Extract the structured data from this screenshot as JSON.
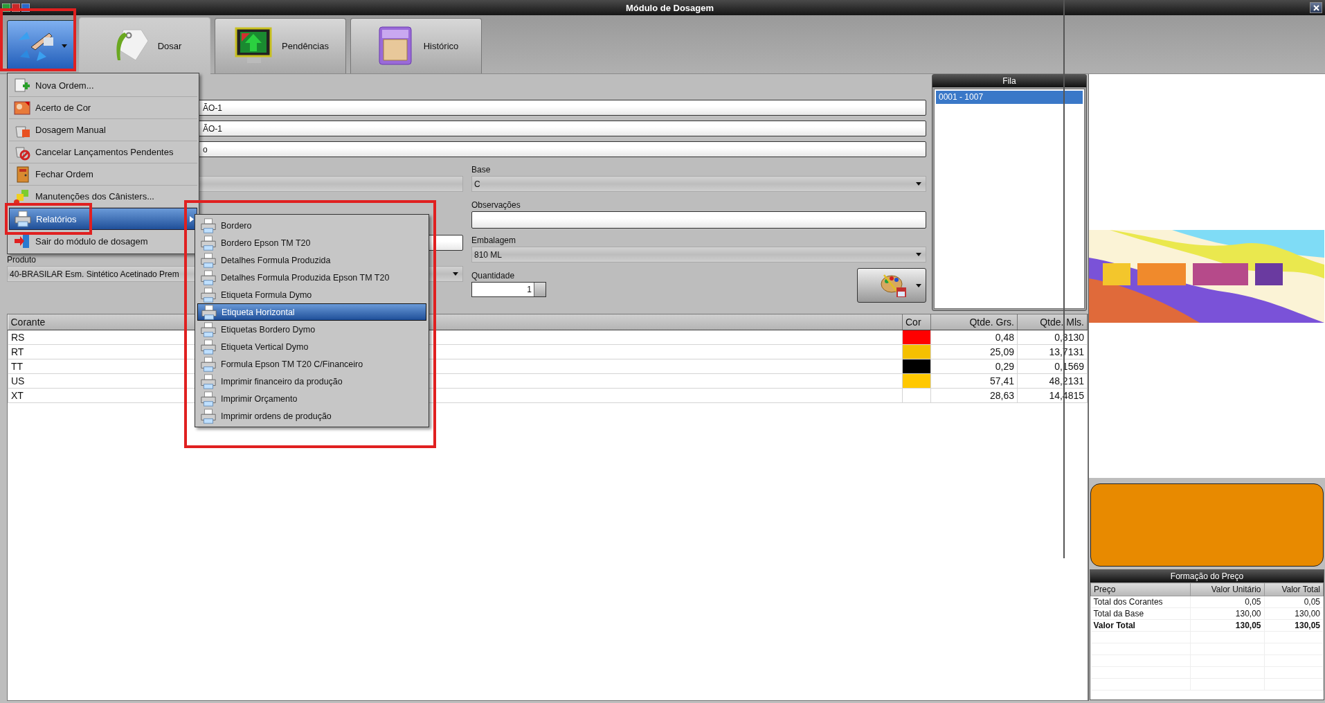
{
  "window": {
    "title": "Módulo de Dosagem"
  },
  "tabs": [
    {
      "label": "Dosar",
      "selected": true
    },
    {
      "label": "Pendências",
      "selected": false
    },
    {
      "label": "Histórico",
      "selected": false
    }
  ],
  "action_menu": {
    "items": [
      {
        "label": "Nova Ordem...",
        "selected": false
      },
      {
        "label": "Acerto de Cor",
        "selected": false
      },
      {
        "label": "Dosagem Manual",
        "selected": false
      },
      {
        "label": "Cancelar Lançamentos Pendentes",
        "selected": false
      },
      {
        "label": "Fechar Ordem",
        "selected": false
      },
      {
        "label": "Manutenções dos Cânisters...",
        "selected": false
      },
      {
        "label": "Relatórios",
        "selected": true,
        "submenu": true
      },
      {
        "label": "Sair do módulo de dosagem",
        "selected": false
      }
    ]
  },
  "submenu": {
    "items": [
      {
        "label": "Bordero",
        "selected": false
      },
      {
        "label": "Bordero Epson TM T20",
        "selected": false
      },
      {
        "label": "Detalhes Formula Produzida",
        "selected": false
      },
      {
        "label": "Detalhes Formula Produzida Epson TM T20",
        "selected": false
      },
      {
        "label": "Etiqueta Formula Dymo",
        "selected": false
      },
      {
        "label": "Etiqueta Horizontal",
        "selected": true
      },
      {
        "label": "Etiquetas Bordero Dymo",
        "selected": false
      },
      {
        "label": "Etiqueta Vertical Dymo",
        "selected": false
      },
      {
        "label": "Formula Epson TM T20 C/Financeiro",
        "selected": false
      },
      {
        "label": "Imprimir financeiro da produção",
        "selected": false
      },
      {
        "label": "Imprimir Orçamento",
        "selected": false
      },
      {
        "label": "Imprimir ordens de produção",
        "selected": false
      }
    ]
  },
  "form": {
    "fields": [
      {
        "value": "ÃO-1"
      },
      {
        "value": "ÃO-1"
      },
      {
        "value": "o"
      }
    ],
    "base": {
      "label": "Base",
      "value": "C"
    },
    "observacoes": {
      "label": "Observações"
    },
    "embalagem": {
      "label": "Embalagem",
      "value": "810 ML"
    },
    "produto": {
      "label": "Produto",
      "value": "40-BRASILAR Esm. Sintético Acetinado Prem"
    },
    "quantidade": {
      "label": "Quantidade",
      "value": "1"
    }
  },
  "queue": {
    "title": "Fila",
    "items": [
      {
        "label": "0001 - 1007",
        "selected": true
      }
    ]
  },
  "colorants_table": {
    "columns": [
      "Corante",
      "Cor",
      "Qtde. Grs.",
      "Qtde. Mls."
    ],
    "rows": [
      {
        "corante": "RS",
        "color": "#ff0000",
        "grams": "0,48",
        "ml": "0,3130"
      },
      {
        "corante": "RT",
        "color": "#f5c000",
        "grams": "25,09",
        "ml": "13,7131"
      },
      {
        "corante": "TT",
        "color": "#000000",
        "grams": "0,29",
        "ml": "0,1569"
      },
      {
        "corante": "US",
        "color": "#ffc800",
        "grams": "57,41",
        "ml": "48,2131"
      },
      {
        "corante": "XT",
        "grams": "28,63",
        "ml": "14,4815"
      }
    ]
  },
  "color_preview": {
    "color": "#e88a00"
  },
  "price_panel": {
    "title": "Formação do Preço",
    "columns": [
      "Preço",
      "Valor Unitário",
      "Valor Total"
    ],
    "rows": [
      {
        "label": "Total dos Corantes",
        "unit": "0,05",
        "total": "0,05",
        "bold": false
      },
      {
        "label": "Total da Base",
        "unit": "130,00",
        "total": "130,00",
        "bold": false
      },
      {
        "label": "Valor Total",
        "unit": "130,05",
        "total": "130,05",
        "bold": true
      }
    ]
  }
}
